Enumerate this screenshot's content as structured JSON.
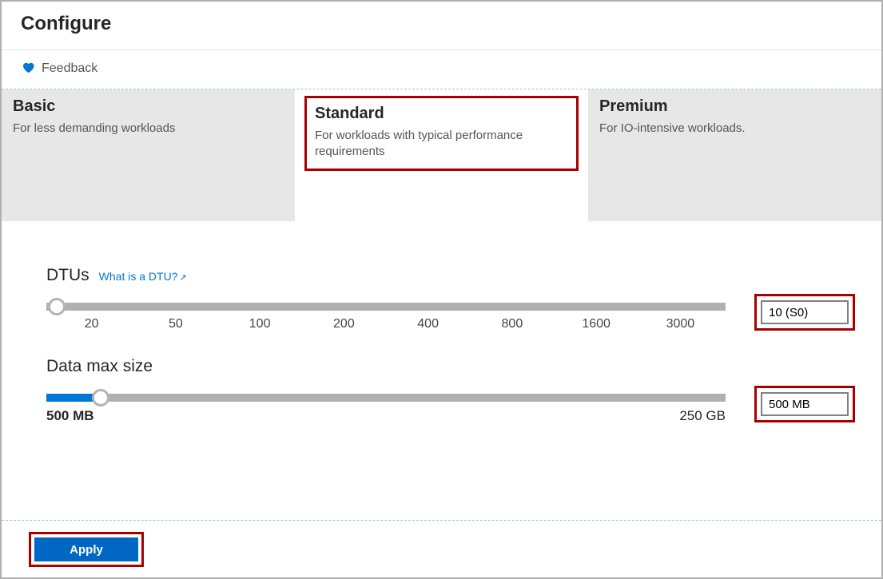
{
  "header": {
    "title": "Configure"
  },
  "feedback": {
    "label": "Feedback",
    "icon": "heart-icon"
  },
  "tiers": [
    {
      "name": "Basic",
      "desc": "For less demanding workloads",
      "selected": false
    },
    {
      "name": "Standard",
      "desc": "For workloads with typical performance requirements",
      "selected": true
    },
    {
      "name": "Premium",
      "desc": "For IO-intensive workloads.",
      "selected": false
    }
  ],
  "dtus": {
    "label": "DTUs",
    "help_text": "What is a DTU?",
    "ticks": [
      "20",
      "50",
      "100",
      "200",
      "400",
      "800",
      "1600",
      "3000"
    ],
    "value": "10 (S0)",
    "thumb_percent": 1.5,
    "fill_percent": 0
  },
  "data_max_size": {
    "label": "Data max size",
    "min_label": "500 MB",
    "max_label": "250 GB",
    "value": "500 MB",
    "thumb_percent": 8,
    "fill_percent": 8
  },
  "footer": {
    "apply_label": "Apply"
  }
}
